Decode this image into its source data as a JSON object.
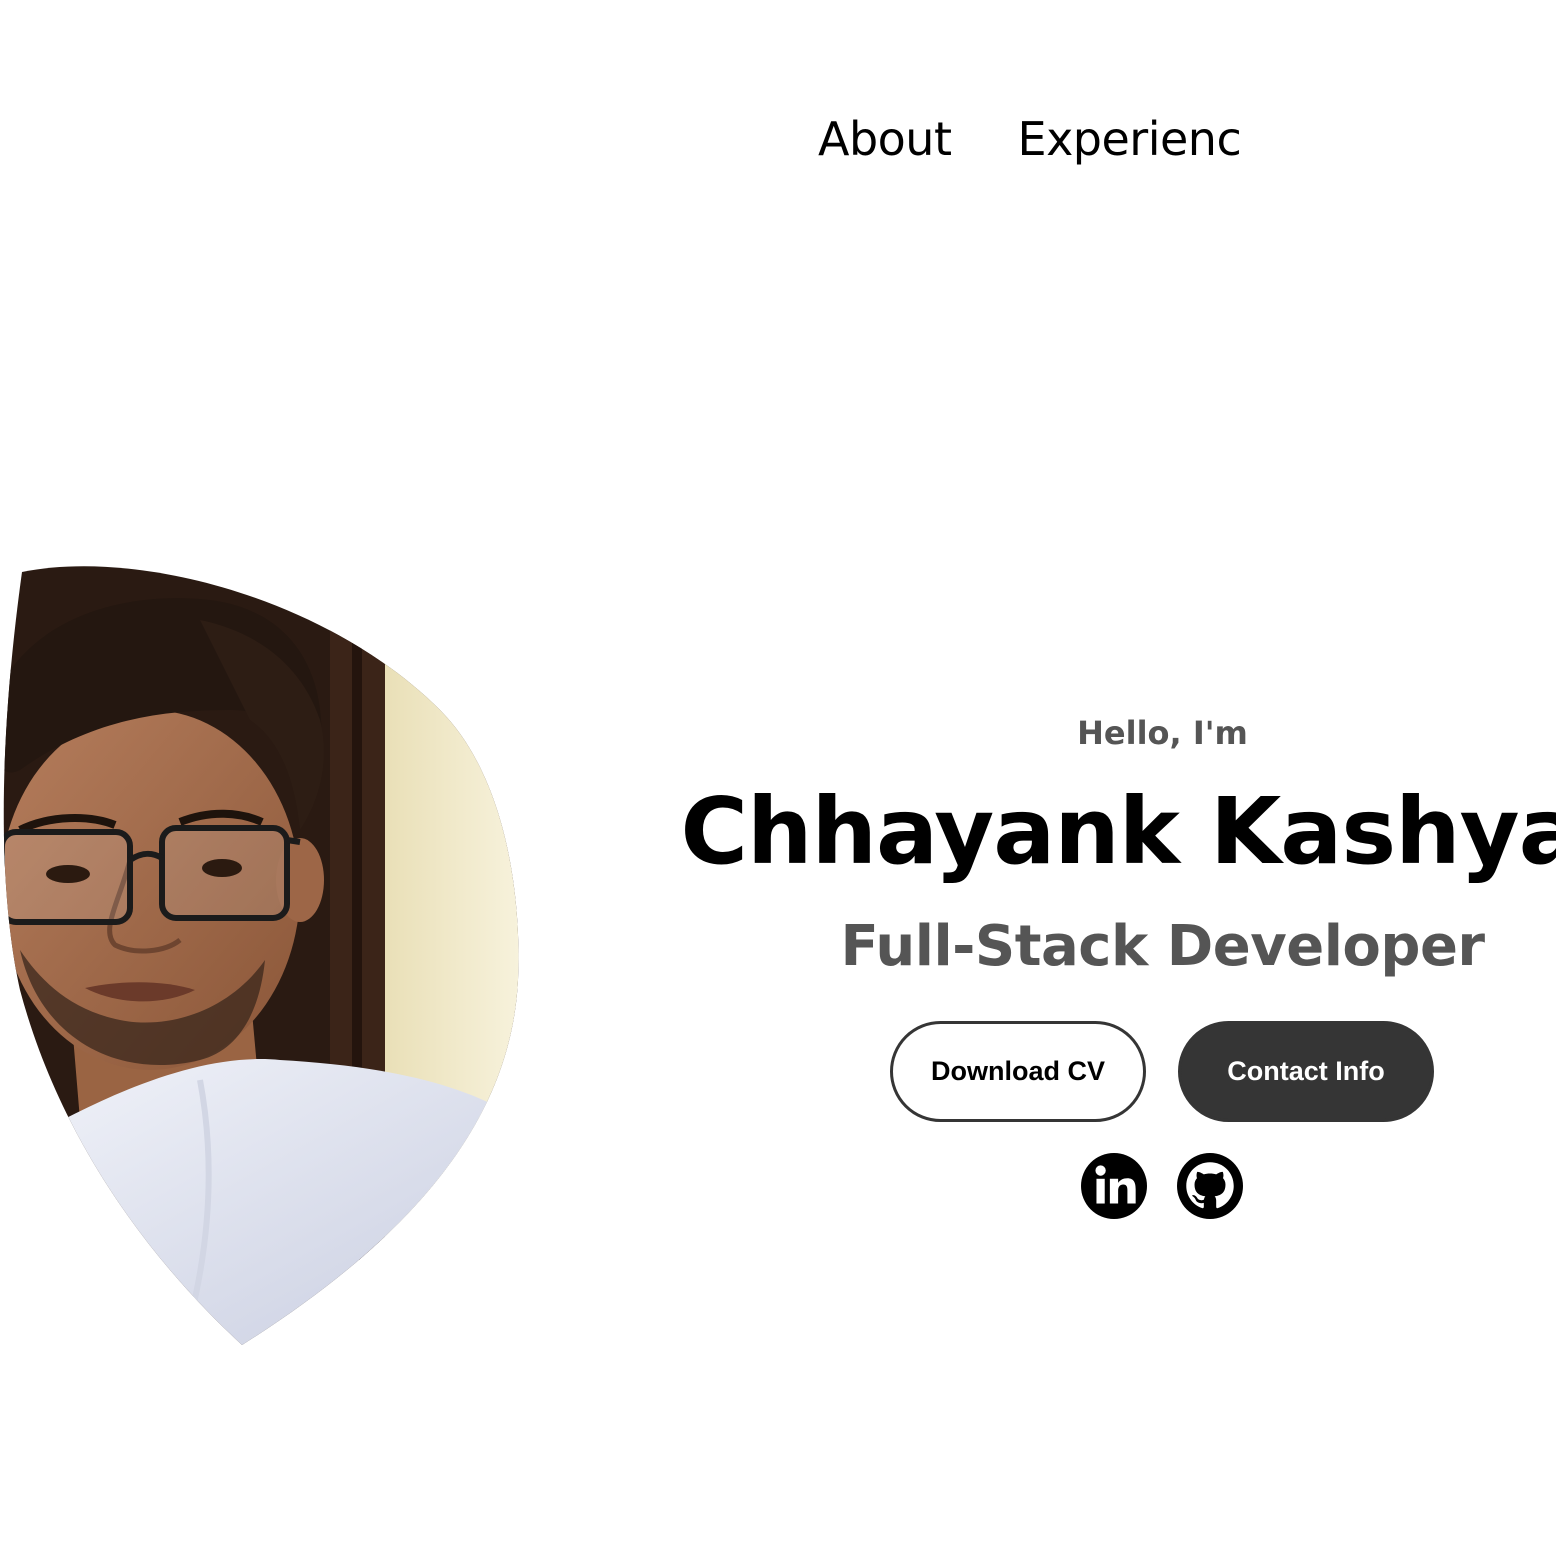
{
  "nav": {
    "links": [
      {
        "label": "About"
      },
      {
        "label": "Experience"
      }
    ]
  },
  "profile": {
    "image_alt": "Profile picture"
  },
  "hero": {
    "greeting": "Hello, I'm",
    "name": "Chhayank Kashyap",
    "title": "Full-Stack Developer"
  },
  "buttons": {
    "download_cv": "Download CV",
    "contact_info": "Contact Info"
  },
  "social": {
    "linkedin_icon": "linkedin-icon",
    "github_icon": "github-icon"
  },
  "colors": {
    "background": "#ffffff",
    "text": "#000000",
    "muted_text": "#555555",
    "button_dark": "#353535",
    "button_text_light": "#ffffff"
  }
}
